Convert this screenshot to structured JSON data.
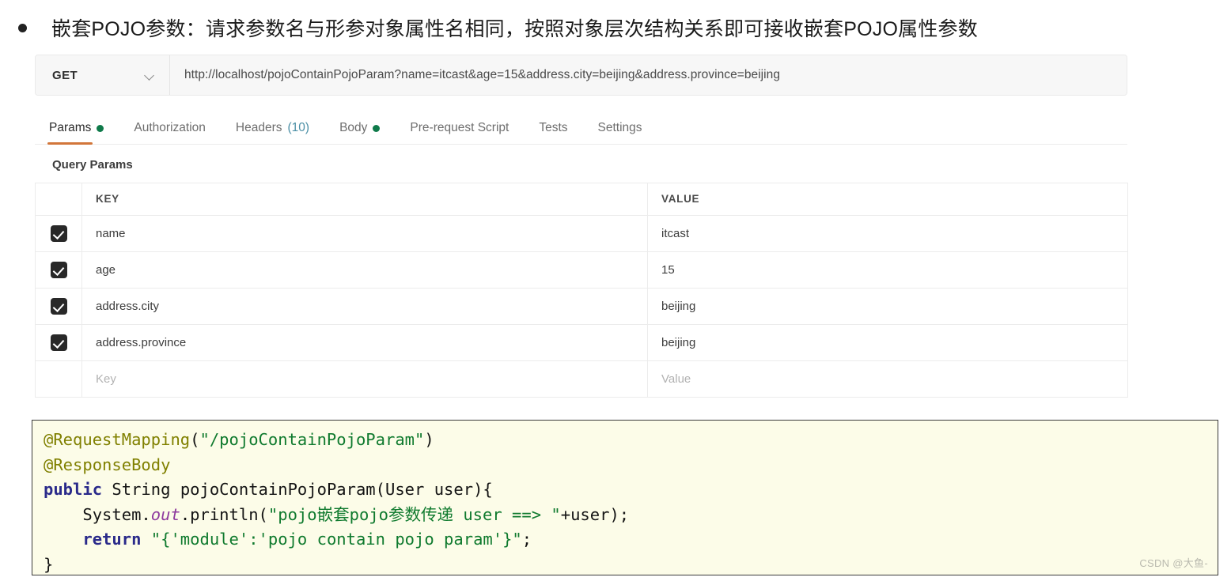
{
  "heading": {
    "bullet": "•",
    "text": "嵌套POJO参数：请求参数名与形参对象属性名相同，按照对象层次结构关系即可接收嵌套POJO属性参数"
  },
  "request": {
    "method": "GET",
    "url": "http://localhost/pojoContainPojoParam?name=itcast&age=15&address.city=beijing&address.province=beijing"
  },
  "tabs": [
    {
      "label": "Params",
      "dot": true,
      "count": "",
      "active": true
    },
    {
      "label": "Authorization",
      "dot": false,
      "count": "",
      "active": false
    },
    {
      "label": "Headers",
      "dot": false,
      "count": "(10)",
      "active": false
    },
    {
      "label": "Body",
      "dot": true,
      "count": "",
      "active": false
    },
    {
      "label": "Pre-request Script",
      "dot": false,
      "count": "",
      "active": false
    },
    {
      "label": "Tests",
      "dot": false,
      "count": "",
      "active": false
    },
    {
      "label": "Settings",
      "dot": false,
      "count": "",
      "active": false
    }
  ],
  "params_section": {
    "title": "Query Params",
    "headers": {
      "key": "KEY",
      "value": "VALUE"
    },
    "rows": [
      {
        "checked": true,
        "key": "name",
        "value": "itcast"
      },
      {
        "checked": true,
        "key": "age",
        "value": "15"
      },
      {
        "checked": true,
        "key": "address.city",
        "value": "beijing"
      },
      {
        "checked": true,
        "key": "address.province",
        "value": "beijing"
      }
    ],
    "new_row": {
      "key_placeholder": "Key",
      "value_placeholder": "Value"
    }
  },
  "code": {
    "line1_anno": "@RequestMapping",
    "line1_paren_open": "(",
    "line1_str": "\"/pojoContainPojoParam\"",
    "line1_paren_close": ")",
    "line2_anno": "@ResponseBody",
    "line3_kw": "public",
    "line3_type": " String ",
    "line3_name": "pojoContainPojoParam",
    "line3_rest": "(User user){",
    "line4_indent": "    ",
    "line4_sys": "System.",
    "line4_field": "out",
    "line4_call": ".println(",
    "line4_str": "\"pojo嵌套pojo参数传递 user ==> \"",
    "line4_rest": "+user);",
    "line5_indent": "    ",
    "line5_kw": "return",
    "line5_space": " ",
    "line5_str": "\"{'module':'pojo contain pojo param'}\"",
    "line5_rest": ";",
    "line6": "}"
  },
  "watermark": "CSDN @大鱼-",
  "colors": {
    "accent_tab_underline": "#d2763a",
    "status_dot_green": "#0f7a4a",
    "checkbox_dark": "#282828",
    "code_background": "#fcfce8",
    "code_string_green": "#0f7a2e",
    "code_annotation_olive": "#808000",
    "code_keyword_blue": "#2a2a8a",
    "code_field_purple": "#8e3a9e"
  }
}
